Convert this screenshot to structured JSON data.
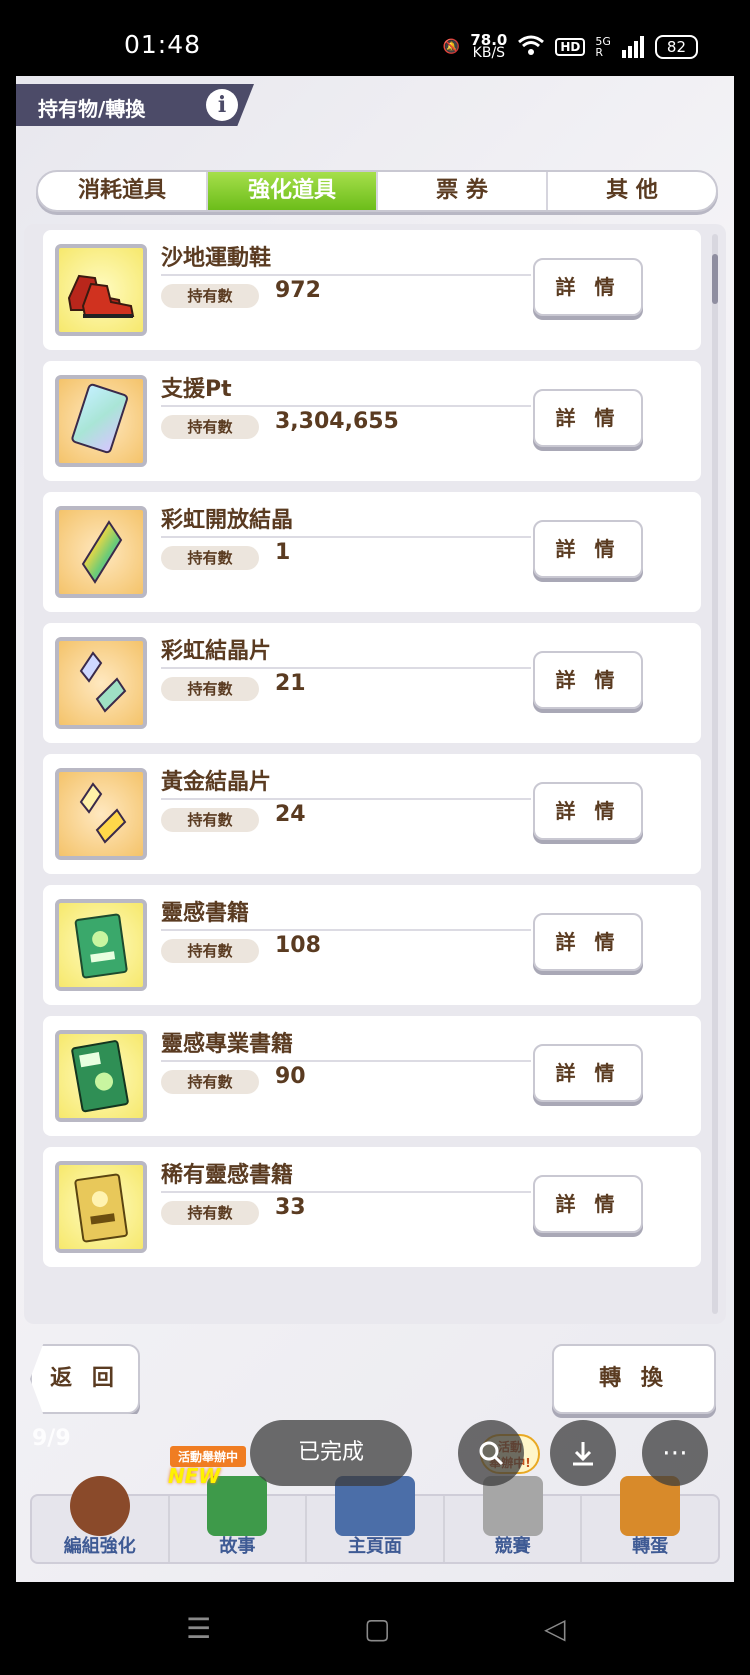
{
  "status_bar": {
    "time": "01:48",
    "net_speed_value": "78.0",
    "net_speed_unit": "KB/S",
    "hd_label": "HD",
    "signal_label": "5G",
    "signal_sub": "R",
    "battery": "82"
  },
  "header": {
    "title": "持有物/轉換",
    "info_label": "i"
  },
  "tabs": [
    {
      "label": "消耗道具",
      "active": false
    },
    {
      "label": "強化道具",
      "active": true
    },
    {
      "label": "票 券",
      "active": false
    },
    {
      "label": "其 他",
      "active": false
    }
  ],
  "item_count_label": "持有數",
  "detail_label": "詳 情",
  "items": [
    {
      "name": "沙地運動鞋",
      "count": "972",
      "icon": "red-shoes-icon"
    },
    {
      "name": "支援Pt",
      "count": "3,304,655",
      "icon": "support-card-icon"
    },
    {
      "name": "彩虹開放結晶",
      "count": "1",
      "icon": "rainbow-crystal-icon"
    },
    {
      "name": "彩虹結晶片",
      "count": "21",
      "icon": "rainbow-shards-icon"
    },
    {
      "name": "黃金結晶片",
      "count": "24",
      "icon": "gold-shards-icon"
    },
    {
      "name": "靈感書籍",
      "count": "108",
      "icon": "green-book-icon"
    },
    {
      "name": "靈感專業書籍",
      "count": "90",
      "icon": "pro-book-icon"
    },
    {
      "name": "稀有靈感書籍",
      "count": "33",
      "icon": "rare-book-icon"
    }
  ],
  "buttons": {
    "back": "返 回",
    "convert": "轉 換"
  },
  "nav": {
    "items": [
      "編組強化",
      "故事",
      "主頁面",
      "競賽",
      "轉蛋"
    ],
    "event_badge": "活動舉辦中",
    "new_badge": "NEW",
    "activity_badge_line1": "活動",
    "activity_badge_line2": "舉辦中!"
  },
  "overlay": {
    "counter": "9/9",
    "done_label": "已完成"
  }
}
